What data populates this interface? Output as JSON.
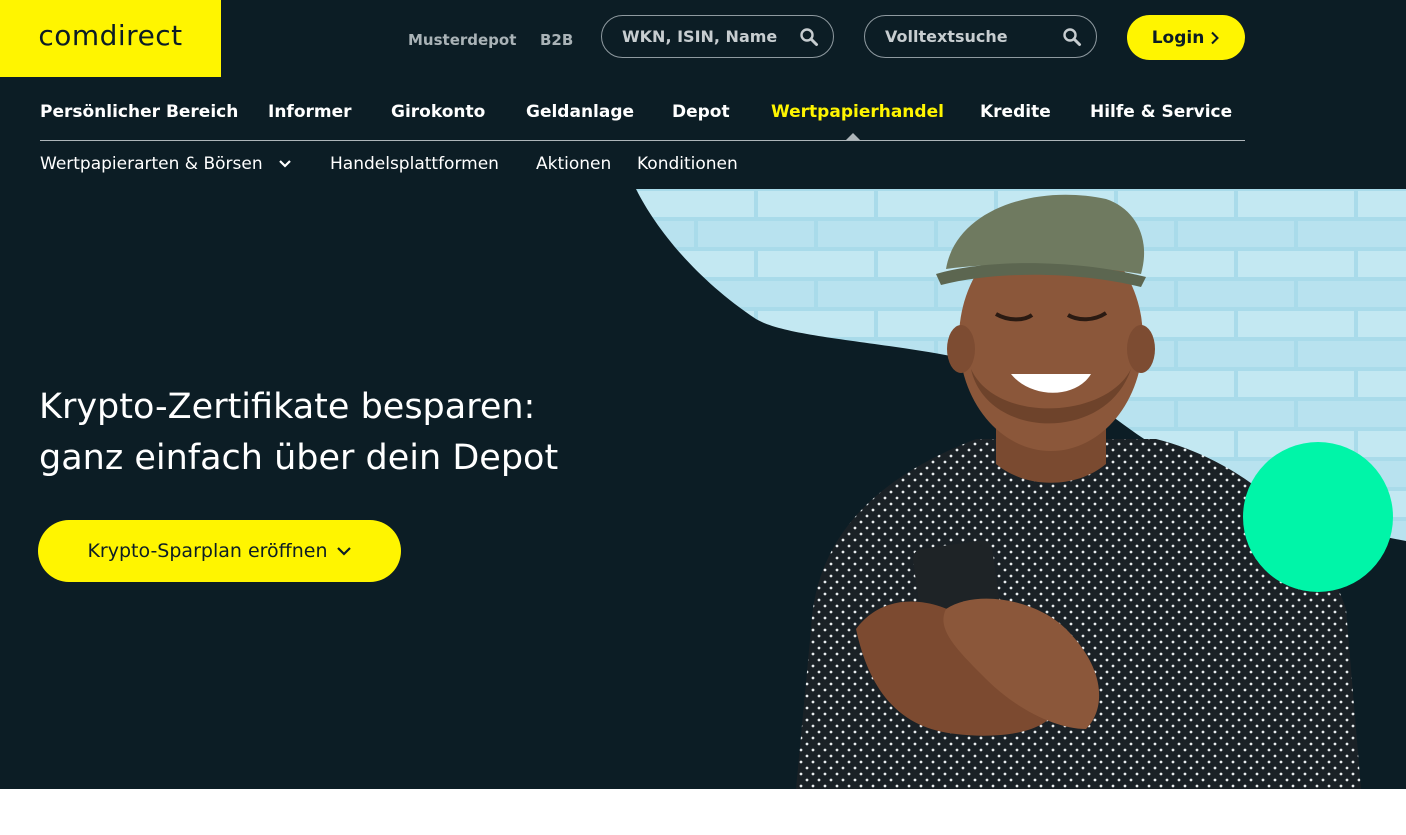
{
  "brand": {
    "logo_text": "comdirect",
    "accent": "#fff500",
    "background": "#0c1d25",
    "green_dot": "#00f5a8"
  },
  "topbar": {
    "links": [
      "Musterdepot",
      "B2B"
    ],
    "search1_placeholder": "WKN, ISIN, Name",
    "search2_placeholder": "Volltextsuche",
    "search_icon": "search-icon",
    "login_label": "Login",
    "login_icon": "chevron-right-icon"
  },
  "mainnav": {
    "items": [
      "Persönlicher Bereich",
      "Informer",
      "Girokonto",
      "Geldanlage",
      "Depot",
      "Wertpapierhandel",
      "Kredite",
      "Hilfe & Service"
    ],
    "active": "Wertpapierhandel"
  },
  "subnav": {
    "items": [
      "Wertpapierarten & Börsen",
      "Handelsplattformen",
      "Aktionen",
      "Konditionen"
    ],
    "dropdown_icon": "chevron-down-icon"
  },
  "hero": {
    "title_line1": "Krypto-Zertifikate besparen:",
    "title_line2": "ganz einfach über dein Depot",
    "cta_label": "Krypto-Sparplan eröffnen",
    "cta_icon": "chevron-down-icon"
  }
}
